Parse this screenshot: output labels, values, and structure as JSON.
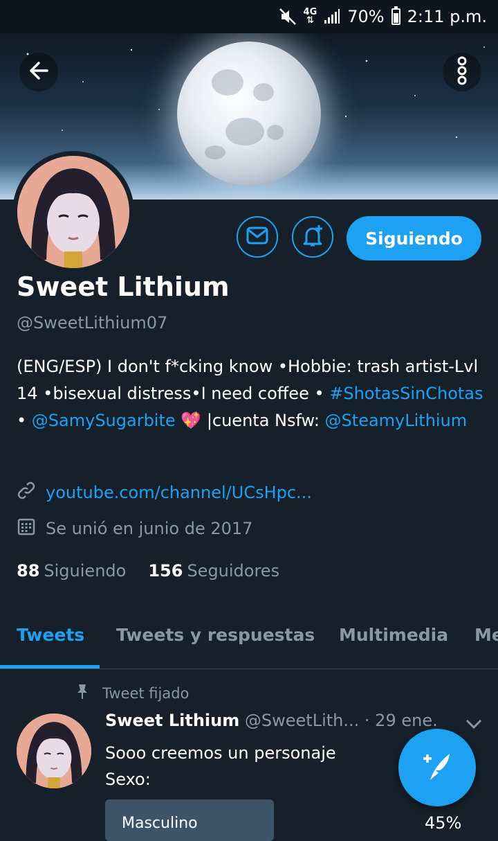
{
  "status_bar": {
    "network": "4G",
    "battery": "70%",
    "time": "2:11 p.m."
  },
  "header": {
    "back_icon": "arrow-left-icon",
    "more_icon": "more-vertical-icon"
  },
  "profile": {
    "name": "Sweet Lithium",
    "handle": "@SweetLithium07",
    "follow_label": "Siguiendo",
    "message_icon": "mail-icon",
    "notify_icon": "bell-plus-icon",
    "bio": {
      "part1": "(ENG/ESP) I don't f*cking know •Hobbie: trash artist-Lvl 14 •bisexual distress•I need coffee • ",
      "hashtag": "#ShotasSinChotas",
      "sep": " • ",
      "mention1": "@SamySugarbite",
      "emoji": "💖",
      "part2": " |cuenta Nsfw: ",
      "mention2": "@SteamyLithium"
    },
    "website": "youtube.com/channel/UCsHpc...",
    "joined": "Se unió en junio de 2017",
    "following_count": "88",
    "following_label": "Siguiendo",
    "followers_count": "156",
    "followers_label": "Seguidores"
  },
  "tabs": [
    {
      "label": "Tweets",
      "active": true
    },
    {
      "label": "Tweets y respuestas",
      "active": false
    },
    {
      "label": "Multimedia",
      "active": false
    },
    {
      "label": "Me",
      "active": false
    }
  ],
  "pinned_tweet": {
    "pinned_label": "Tweet fijado",
    "author": "Sweet Lithium",
    "handle": "@SweetLith...",
    "date": "29 ene.",
    "text_line1": "Sooo creemos un personaje",
    "text_line2": "Sexo:",
    "poll_option": "Masculino",
    "poll_percent": "45%"
  },
  "colors": {
    "accent": "#1da1f2",
    "background": "#15202b",
    "muted": "#8899a6"
  }
}
